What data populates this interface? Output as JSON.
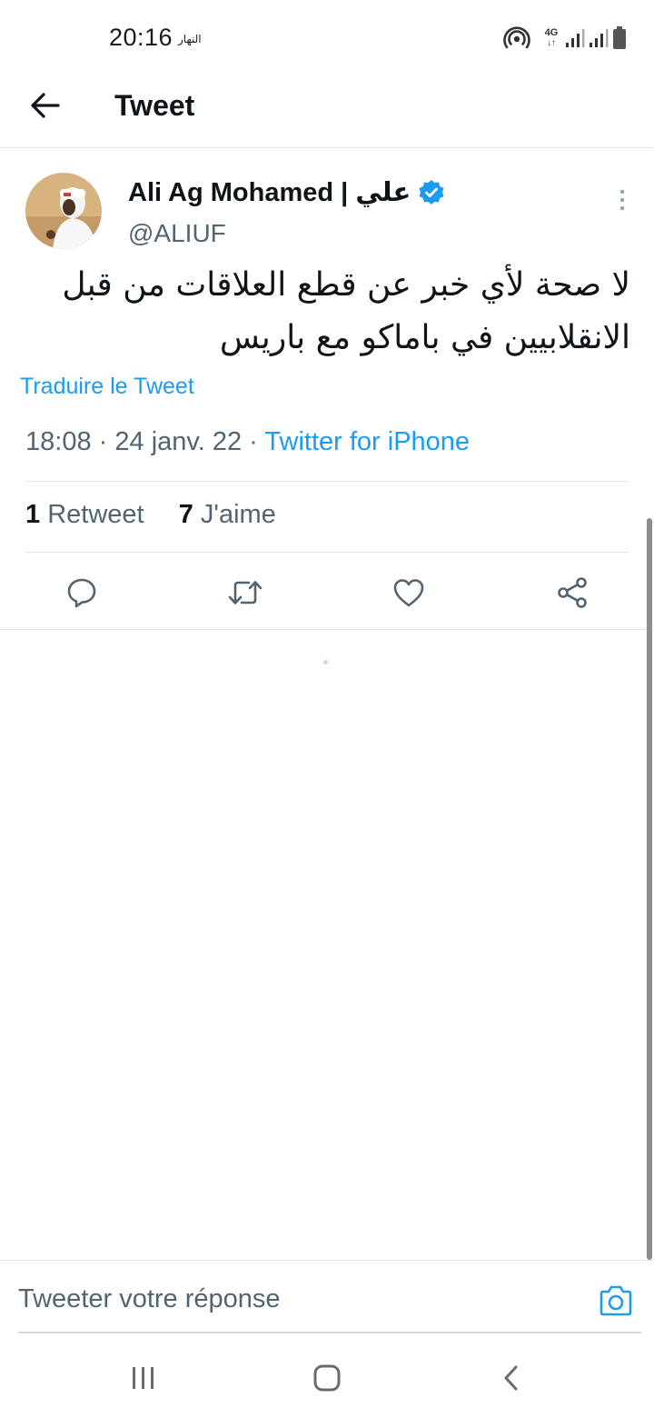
{
  "status_bar": {
    "time": "20:16",
    "notification_text": "النهار",
    "network_type": "4G",
    "icons": [
      "hotspot-icon",
      "network-4g-icon",
      "signal-icon",
      "signal-icon",
      "battery-icon"
    ]
  },
  "header": {
    "title": "Tweet",
    "back_icon": "arrow-left-icon"
  },
  "tweet": {
    "author_name": "Ali Ag Mohamed | علي",
    "verified_icon": "verified-badge-icon",
    "handle": "@ALIUF",
    "more_icon": "more-vertical-icon",
    "text": "لا صحة لأي خبر عن قطع العلاقات من قبل الانقلابيين في باماكو مع باريس",
    "translate_label": "Traduire le Tweet",
    "time": "18:08",
    "date": "24 janv. 22",
    "separator": "·",
    "client": "Twitter for iPhone",
    "retweet_count": "1",
    "retweet_label": "Retweet",
    "like_count": "7",
    "like_label": "J'aime"
  },
  "actions": [
    "reply-icon",
    "retweet-icon",
    "like-icon",
    "share-icon"
  ],
  "reply": {
    "placeholder": "Tweeter votre réponse",
    "camera_icon": "camera-icon"
  },
  "nav_bar": [
    "recents-icon",
    "home-icon",
    "back-icon"
  ],
  "colors": {
    "accent": "#1d9bf0",
    "text_primary": "#0f1419",
    "text_secondary": "#536471",
    "divider": "#e1e4e6"
  }
}
